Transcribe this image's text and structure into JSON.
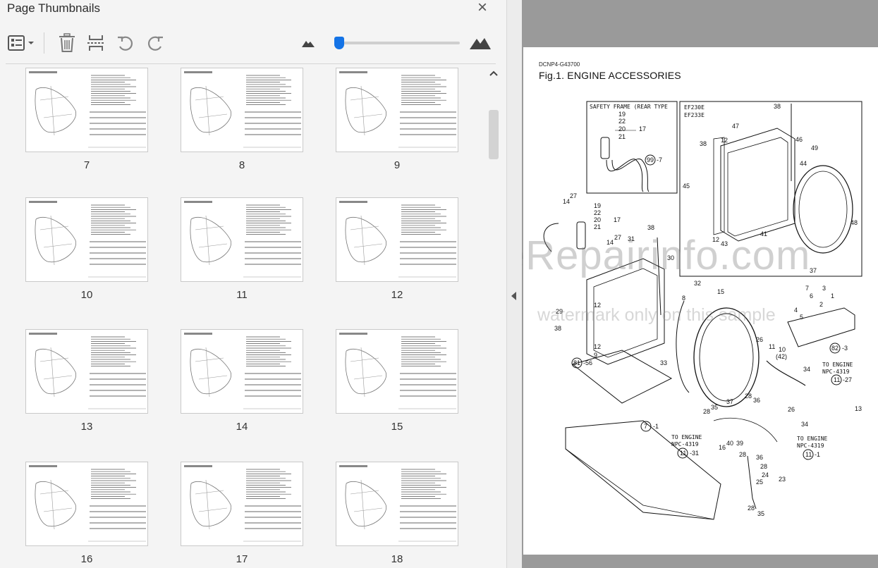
{
  "panel": {
    "title": "Page Thumbnails",
    "close_icon": "close-icon"
  },
  "toolbar": {
    "options_icon": "thumbnail-options-icon",
    "delete_icon": "trash-icon",
    "extract_icon": "extract-pages-icon",
    "rotate_ccw_icon": "rotate-counterclockwise-icon",
    "rotate_cw_icon": "rotate-clockwise-icon",
    "zoom_out_icon": "small-mountain-icon",
    "zoom_in_icon": "large-mountain-icon",
    "zoom_slider_fraction": 0.02
  },
  "thumbnails": [
    {
      "page": "7"
    },
    {
      "page": "8"
    },
    {
      "page": "9"
    },
    {
      "page": "10"
    },
    {
      "page": "11"
    },
    {
      "page": "12"
    },
    {
      "page": "13"
    },
    {
      "page": "14"
    },
    {
      "page": "15"
    },
    {
      "page": "16"
    },
    {
      "page": "17"
    },
    {
      "page": "18"
    }
  ],
  "document": {
    "code": "DCNP4-G43700",
    "title": "Fig.1.  ENGINE ACCESSORIES",
    "inset_left_title": "SAFETY FRAME (REAR TYPE",
    "inset_right_models": [
      "EF230E",
      "EF233E"
    ],
    "to_engine_1": {
      "label": "TO ENGINE",
      "ref": "NPC-4319",
      "page": "-27",
      "circle": "11"
    },
    "to_engine_2": {
      "label": "TO ENGINE",
      "ref": "NPC-4319",
      "page": "-31",
      "circle": "11"
    },
    "to_engine_3": {
      "label": "TO ENGINE",
      "ref": "NPC-4319",
      "page": "-1",
      "circle": "11"
    },
    "watermark_main": "eRepairinfo.com",
    "watermark_sub": "watermark only on this sample"
  },
  "colors": {
    "accent": "#1473e6",
    "panel_bg": "#f4f4f4",
    "doc_bg": "#9a9a9a"
  }
}
